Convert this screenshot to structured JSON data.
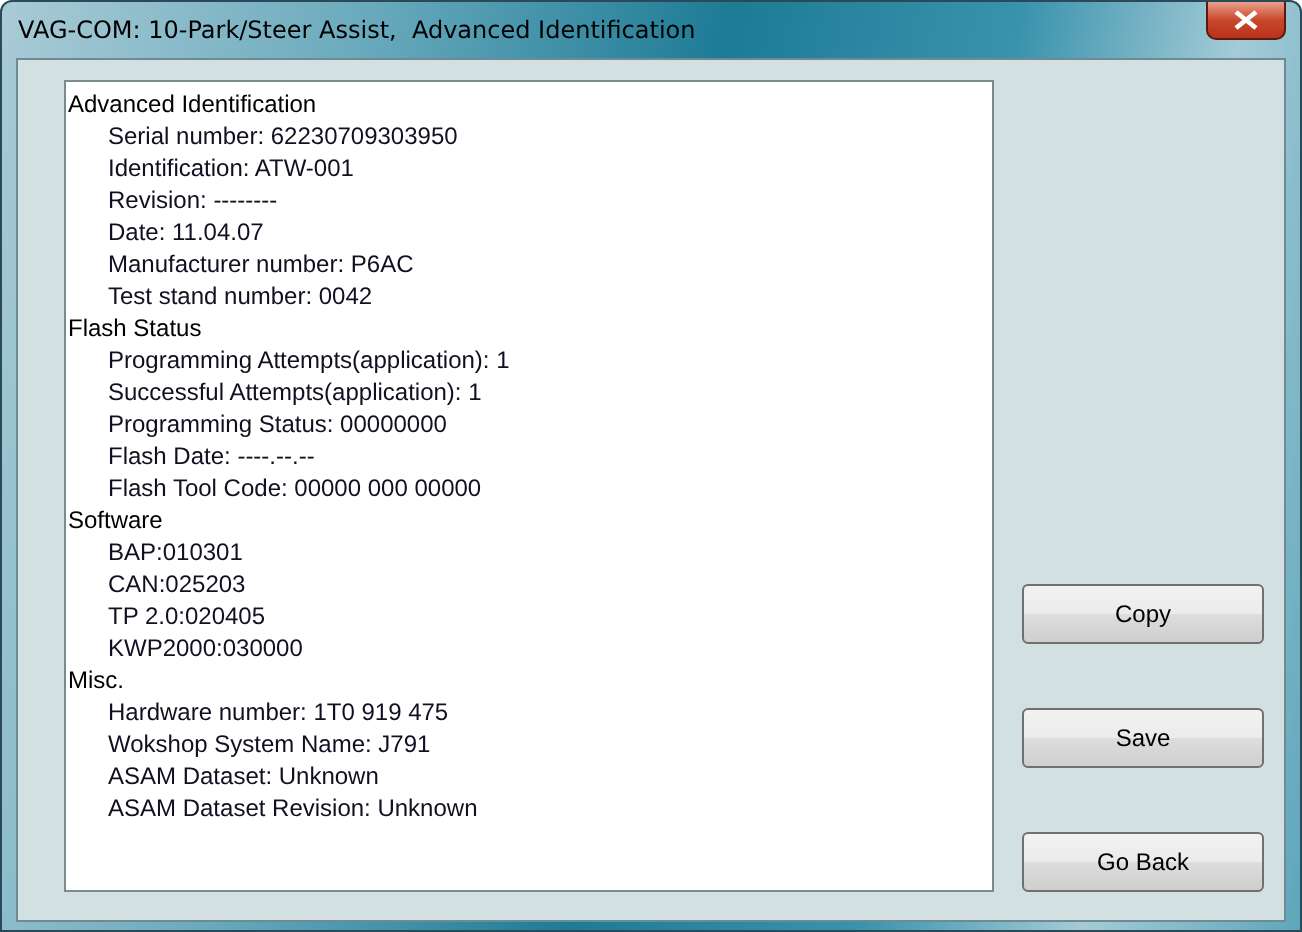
{
  "window": {
    "title": "VAG-COM: 10-Park/Steer Assist,  Advanced Identification"
  },
  "sections": [
    {
      "heading": "Advanced Identification",
      "items": [
        "Serial number: 62230709303950",
        "Identification: ATW-001",
        "Revision: --------",
        "Date: 11.04.07",
        "Manufacturer number: P6AC",
        "Test stand number: 0042"
      ]
    },
    {
      "heading": "Flash Status",
      "items": [
        "Programming Attempts(application): 1",
        "Successful Attempts(application): 1",
        "Programming Status: 00000000",
        "Flash Date: ----.--.--",
        "Flash Tool Code: 00000 000 00000"
      ]
    },
    {
      "heading": "Software",
      "items": [
        "BAP:010301",
        "CAN:025203",
        "TP 2.0:020405",
        "KWP2000:030000"
      ]
    },
    {
      "heading": "Misc.",
      "items": [
        "Hardware number: 1T0 919 475",
        "Wokshop System Name: J791",
        "ASAM Dataset: Unknown",
        "ASAM Dataset Revision: Unknown"
      ]
    }
  ],
  "buttons": [
    "Copy",
    "Save",
    "Go Back"
  ]
}
